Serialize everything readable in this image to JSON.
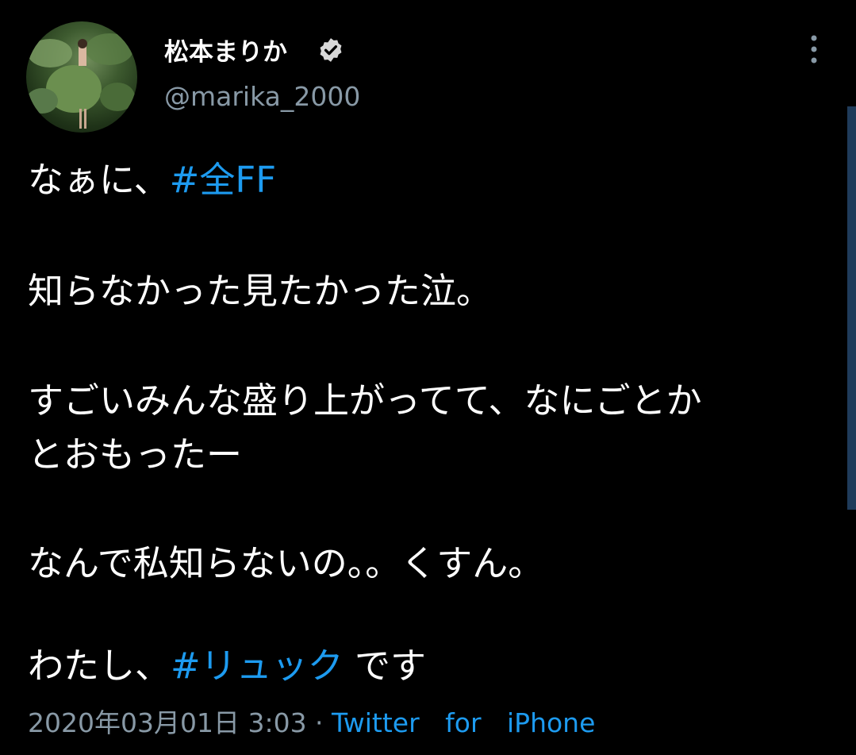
{
  "user": {
    "display_name": "松本まりか",
    "handle": "@marika_2000",
    "verified": true
  },
  "tweet": {
    "line1_text": "なぁに、",
    "line1_hashtag": "#全FF",
    "line2": "知らなかった見たかった泣。",
    "line3": "すごいみんな盛り上がってて、なにごとか",
    "line4": "とおもったー",
    "line5": "なんで私知らないの。。くすん。",
    "line6_text": "わたし、",
    "line6_hashtag": "#リュック",
    "line6_tail": " です"
  },
  "meta": {
    "timestamp": "2020年03月01日 3:03",
    "separator": " · ",
    "source": "Twitter for iPhone"
  },
  "icons": {
    "verified": "verified-badge-icon",
    "more": "more-vertical-icon"
  },
  "colors": {
    "background": "#000000",
    "text": "#ffffff",
    "secondary": "#8899a6",
    "link": "#1d9bf0"
  }
}
